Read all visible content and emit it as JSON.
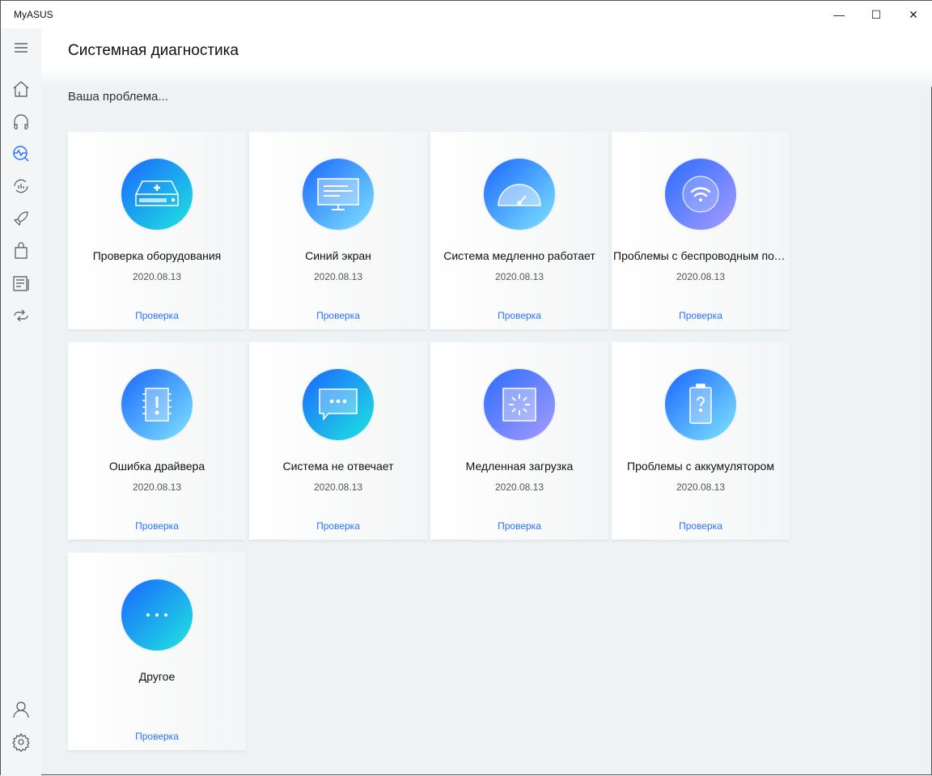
{
  "app": {
    "title": "MyASUS"
  },
  "window": {
    "minimize": "—",
    "maximize": "☐",
    "close": "✕"
  },
  "page": {
    "title": "Системная диагностика",
    "subtitle": "Ваша проблема..."
  },
  "cards": [
    {
      "title": "Проверка оборудования",
      "date": "2020.08.13",
      "action": "Проверка",
      "icon": "hard-drive-icon"
    },
    {
      "title": "Синий экран",
      "date": "2020.08.13",
      "action": "Проверка",
      "icon": "monitor-icon"
    },
    {
      "title": "Система медленно работает",
      "date": "2020.08.13",
      "action": "Проверка",
      "icon": "speedometer-icon"
    },
    {
      "title": "Проблемы с беспроводным под...",
      "date": "2020.08.13",
      "action": "Проверка",
      "icon": "wifi-icon"
    },
    {
      "title": "Ошибка драйвера",
      "date": "2020.08.13",
      "action": "Проверка",
      "icon": "chip-warning-icon"
    },
    {
      "title": "Система не отвечает",
      "date": "2020.08.13",
      "action": "Проверка",
      "icon": "message-screen-icon"
    },
    {
      "title": "Медленная загрузка",
      "date": "2020.08.13",
      "action": "Проверка",
      "icon": "loading-icon"
    },
    {
      "title": "Проблемы с аккумулятором",
      "date": "2020.08.13",
      "action": "Проверка",
      "icon": "battery-question-icon"
    },
    {
      "title": "Другое",
      "date": "",
      "action": "Проверка",
      "icon": "more-icon"
    }
  ],
  "colors": {
    "accent": "#2a73ff",
    "active_nav": "#2a73ff"
  }
}
